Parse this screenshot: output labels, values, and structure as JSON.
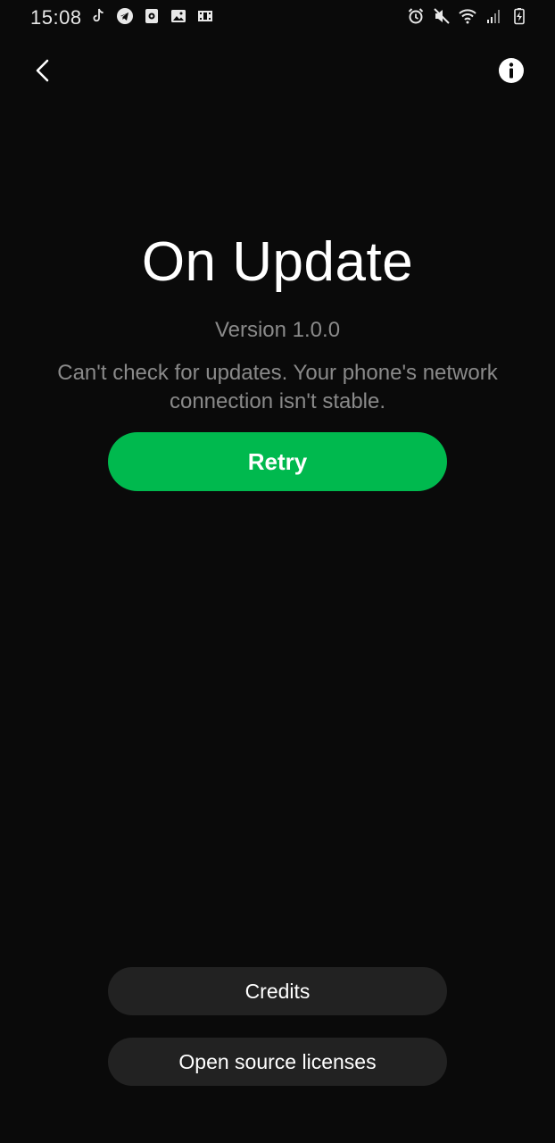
{
  "status_bar": {
    "time": "15:08",
    "left_icons": [
      "tiktok-icon",
      "telegram-icon",
      "screen-recorder-icon",
      "gallery-icon",
      "video-icon"
    ],
    "right_icons": [
      "alarm-icon",
      "mute-icon",
      "wifi-icon",
      "signal-icon",
      "battery-charging-icon"
    ]
  },
  "header": {
    "back_icon": "back-chevron-icon",
    "info_icon": "info-icon"
  },
  "main": {
    "title": "On Update",
    "version": "Version 1.0.0",
    "message": "Can't check for updates. Your phone's network connection isn't stable.",
    "retry_label": "Retry"
  },
  "footer": {
    "credits_label": "Credits",
    "licenses_label": "Open source licenses"
  },
  "colors": {
    "background": "#0a0a0a",
    "accent": "#00b94e",
    "secondary_button": "#222222",
    "muted_text": "#8a8a8a"
  }
}
